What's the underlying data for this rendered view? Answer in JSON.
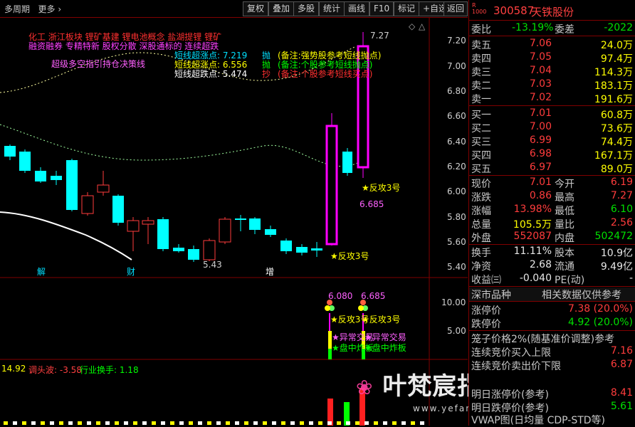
{
  "toolbar": {
    "period": "多周期",
    "more": "更多",
    "buttons": [
      "复权",
      "叠加",
      "多股",
      "统计",
      "画线",
      "F10",
      "标记",
      "+自选",
      "返回"
    ]
  },
  "stock": {
    "code": "300587",
    "name": "天铁股份",
    "prefix": "R\n1000"
  },
  "annotations": {
    "line1": "化工     浙江板块  锂矿基建 锂电池概念 盐湖提锂 锂矿",
    "line2": "融资融券 专精特新 股权分散 深股通标的 连续超跌",
    "super": "超级多空指引持仓决策线",
    "chase": "短线超涨点: 7.219",
    "chase_tag": "抛",
    "chase_note": "(备注:强势股参考短线抛点)",
    "up": "短线超涨点:    6.556",
    "up_tag": "抛",
    "up_note": "(备注:个股参考短线抛点)",
    "down": "短线超跌点:    5.474",
    "down_tag": "抄",
    "down_note": "(备注:个股参考短线买点)"
  },
  "price_labels": {
    "high": "7.27",
    "low": "5.43",
    "mark1": "★反攻3号",
    "mark1_val": "6.685",
    "mark2": "★反攻3号",
    "news1": "解",
    "news2": "财",
    "news3": "增"
  },
  "yaxis": [
    "7.20",
    "7.00",
    "6.80",
    "6.60",
    "6.40",
    "6.20",
    "6.00",
    "5.80",
    "5.60",
    "5.40"
  ],
  "sub_yaxis": [
    "10.00",
    "5.00"
  ],
  "indicator": {
    "left": "14.92",
    "l1": "调头波: -3.58",
    "l2": "行业换手: 1.18",
    "v1": "6.080",
    "v2": "6.685",
    "f1": "★反攻3号",
    "f2": "★反攻3号",
    "e1": "★异常交易",
    "e2": "★异常交易",
    "z1": "★盘中炸板",
    "z2": "★盘中炸板"
  },
  "quote": {
    "weibi": "委比",
    "weibi_v": "-13.19%",
    "weicha": "委差",
    "weicha_v": "-2022",
    "asks": [
      {
        "label": "卖五",
        "price": "7.06",
        "vol": "24.0万"
      },
      {
        "label": "卖四",
        "price": "7.05",
        "vol": "97.4万"
      },
      {
        "label": "卖三",
        "price": "7.04",
        "vol": "114.3万"
      },
      {
        "label": "卖二",
        "price": "7.03",
        "vol": "183.1万"
      },
      {
        "label": "卖一",
        "price": "7.02",
        "vol": "191.6万"
      }
    ],
    "bids": [
      {
        "label": "买一",
        "price": "7.01",
        "vol": "60.8万"
      },
      {
        "label": "买二",
        "price": "7.00",
        "vol": "73.6万"
      },
      {
        "label": "买三",
        "price": "6.99",
        "vol": "74.4万"
      },
      {
        "label": "买四",
        "price": "6.98",
        "vol": "167.1万"
      },
      {
        "label": "买五",
        "price": "6.97",
        "vol": "89.0万"
      }
    ],
    "stats": [
      {
        "l1": "现价",
        "v1": "7.01",
        "c1": "red",
        "l2": "今开",
        "v2": "6.19",
        "c2": "red"
      },
      {
        "l1": "涨跌",
        "v1": "0.86",
        "c1": "red",
        "l2": "最高",
        "v2": "7.27",
        "c2": "red"
      },
      {
        "l1": "涨幅",
        "v1": "13.98%",
        "c1": "red",
        "l2": "最低",
        "v2": "6.10",
        "c2": "green"
      },
      {
        "l1": "总量",
        "v1": "105.5万",
        "c1": "yellow",
        "l2": "量比",
        "v2": "2.56",
        "c2": "red"
      },
      {
        "l1": "外盘",
        "v1": "552087",
        "c1": "red",
        "l2": "内盘",
        "v2": "502472",
        "c2": "green"
      }
    ],
    "stats2": [
      {
        "l1": "换手",
        "v1": "11.11%",
        "l2": "股本",
        "v2": "10.9亿"
      },
      {
        "l1": "净资",
        "v1": "2.68",
        "l2": "流通",
        "v2": "9.49亿"
      },
      {
        "l1": "收益㈢",
        "v1": "-0.040",
        "l2": "PE(动)",
        "v2": "-"
      }
    ],
    "market": "深市品种",
    "market_note": "相关数据仅供参考",
    "limit_up": "涨停价",
    "limit_up_v": "7.38 (20.0%)",
    "limit_down": "跌停价",
    "limit_down_v": "4.92 (20.0%)",
    "cage": "笼子价格2%(随基准价调整)参考",
    "auction_buy": "连续竞价买入上限",
    "auction_buy_v": "7.16",
    "auction_sell": "连续竞价卖出价下限",
    "auction_sell_v": "6.87",
    "tmr_up": "明日涨停价(参考)",
    "tmr_up_v": "8.41",
    "tmr_down": "明日跌停价(参考)",
    "tmr_down_v": "5.61",
    "vwap": "VWAP图(日均量 CDP-STD等)"
  },
  "watermark": {
    "title": "叶梵宸指标公式网",
    "sub": "www.yefanchen.com  指标订阅"
  },
  "colors": {
    "up": "#ff3c3c",
    "down": "#00ffff",
    "accent": "#ff00ff",
    "grid": "#800000"
  }
}
